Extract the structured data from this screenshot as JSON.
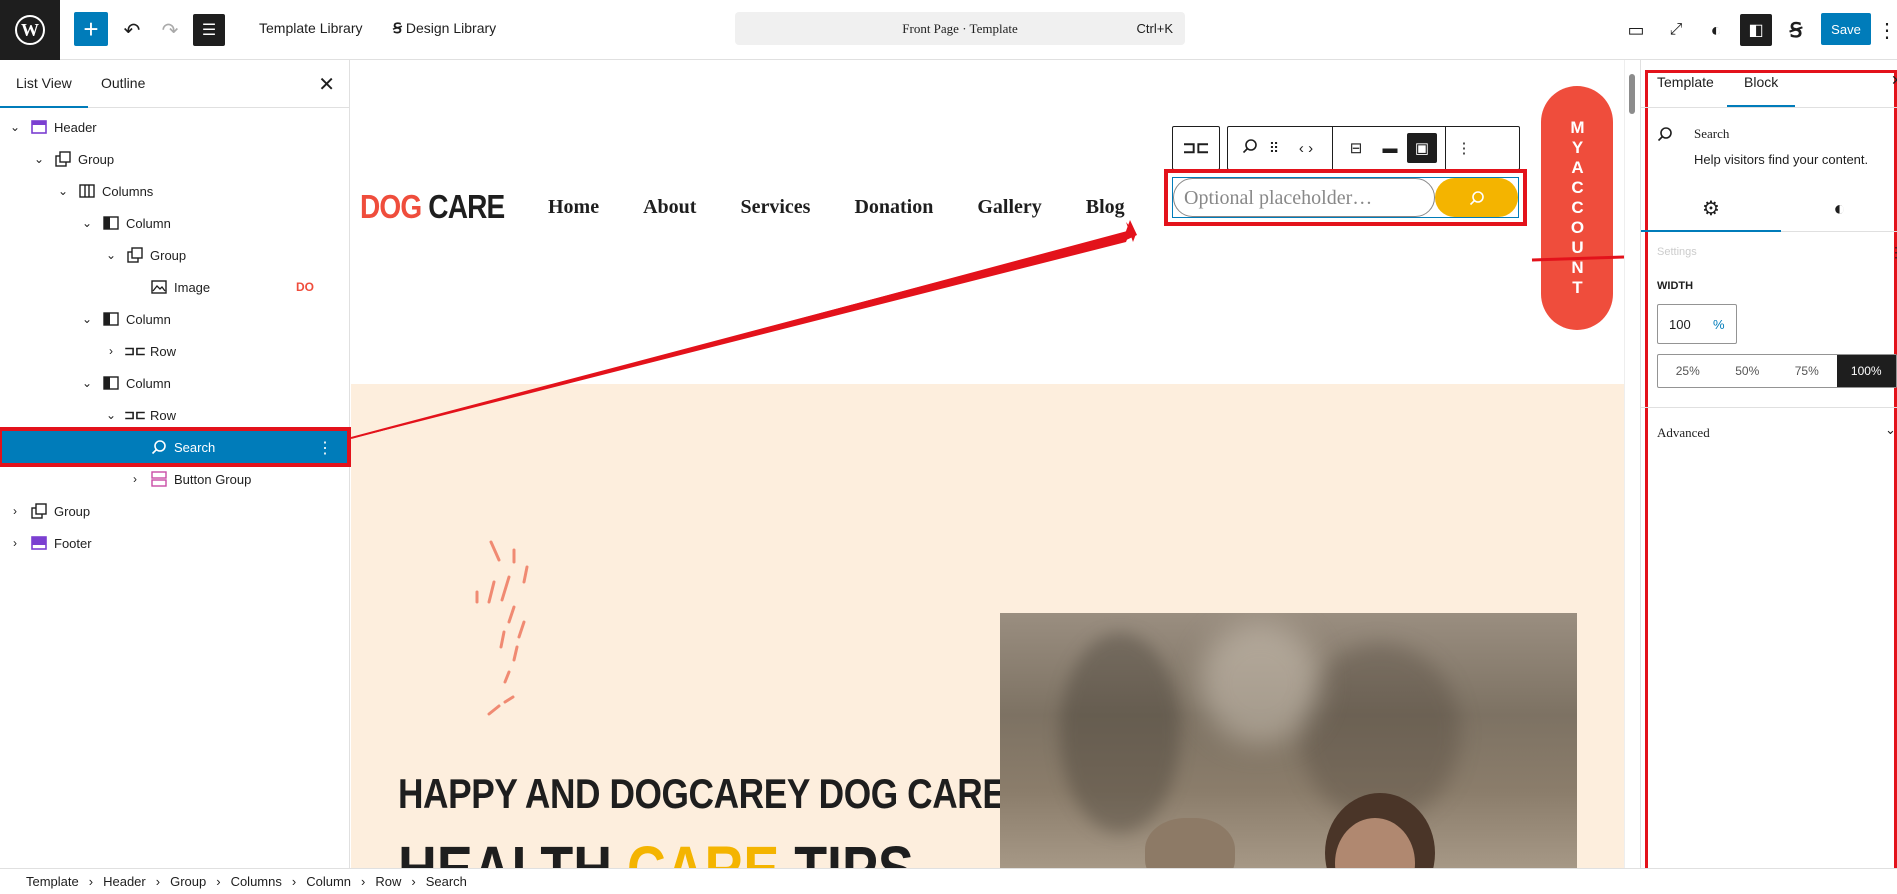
{
  "topbar": {
    "template_library": "Template Library",
    "design_library": "Design Library",
    "command_title": "Front Page · Template",
    "command_shortcut": "Ctrl+K",
    "save_label": "Save"
  },
  "list_view": {
    "tabs": [
      "List View",
      "Outline"
    ],
    "rows": [
      {
        "label": "Header"
      },
      {
        "label": "Group"
      },
      {
        "label": "Columns"
      },
      {
        "label": "Column"
      },
      {
        "label": "Group"
      },
      {
        "label": "Image",
        "badge": "DO"
      },
      {
        "label": "Column"
      },
      {
        "label": "Row"
      },
      {
        "label": "Column"
      },
      {
        "label": "Row"
      },
      {
        "label": "Search"
      },
      {
        "label": "Button Group"
      },
      {
        "label": "Group"
      },
      {
        "label": "Footer"
      }
    ]
  },
  "site": {
    "logo_dog": "DOG",
    "logo_care": "CARE",
    "nav": [
      "Home",
      "About",
      "Services",
      "Donation",
      "Gallery",
      "Blog"
    ],
    "search_placeholder": "Optional placeholder…",
    "account_letters": "MYACCOUNT",
    "hero_line1": "HAPPY AND DOGCAREY DOG CARE",
    "hero_line2_a": "HEALTH",
    "hero_line2_b": "CARE",
    "hero_line2_c": "TIPS"
  },
  "sidebar": {
    "tabs": [
      "Template",
      "Block"
    ],
    "block_name": "Search",
    "block_desc": "Help visitors find your content.",
    "section_heading": "Settings",
    "width_label": "WIDTH",
    "width_value": "100",
    "width_unit": "%",
    "width_presets": [
      "25%",
      "50%",
      "75%",
      "100%"
    ],
    "advanced": "Advanced"
  },
  "breadcrumb": [
    "Template",
    "Header",
    "Group",
    "Columns",
    "Column",
    "Row",
    "Search"
  ],
  "colors": {
    "accent": "#007cba",
    "annotation_red": "#e3121b",
    "brand_yellow": "#f4b400",
    "brand_coral": "#ef4d3c",
    "hero_bg": "#fdeedd"
  }
}
